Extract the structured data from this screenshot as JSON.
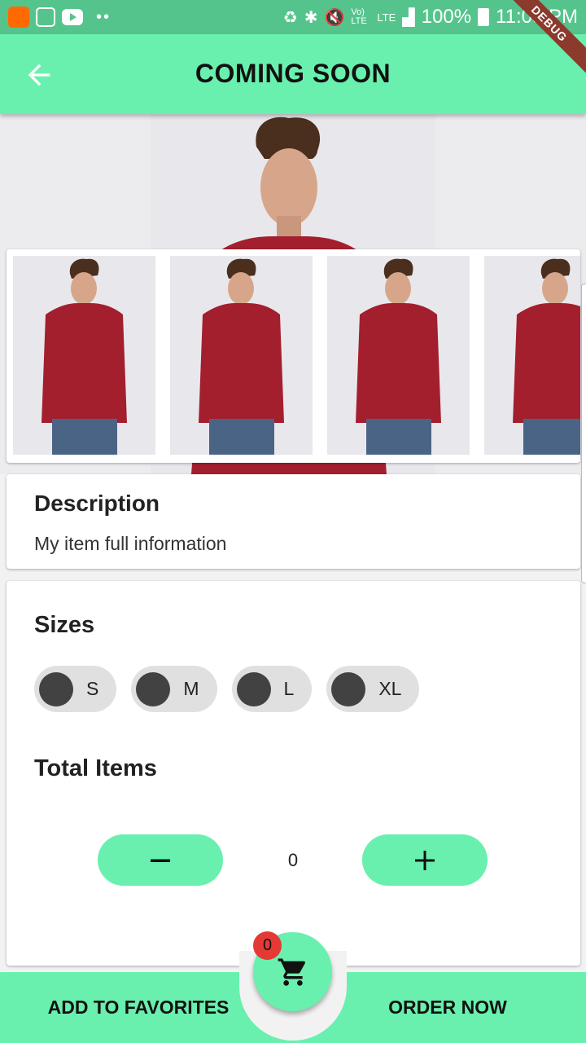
{
  "status_bar": {
    "time": "11:05 PM",
    "battery": "100%",
    "network": "LTE",
    "volte": "Vo) LTE",
    "icons": [
      "app-orange-icon",
      "app-outline-icon",
      "youtube-icon",
      "battery-saver-icon",
      "bluetooth-icon",
      "mute-icon",
      "signal-icon",
      "battery-icon"
    ]
  },
  "debug_banner": "DEBUG",
  "app_bar": {
    "title": "COMING SOON",
    "back_icon": "arrow-back-icon"
  },
  "description": {
    "title": "Description",
    "text": "My item full information"
  },
  "sizes": {
    "title": "Sizes",
    "options": [
      "S",
      "M",
      "L",
      "XL"
    ]
  },
  "quantity": {
    "title": "Total Items",
    "value": "0"
  },
  "bottom_bar": {
    "favorites_label": "ADD TO FAVORITES",
    "order_label": "ORDER NOW",
    "cart_badge": "0",
    "cart_icon": "shopping-cart-icon"
  },
  "colors": {
    "accent": "#69f0ae",
    "status_bar": "#55c48c",
    "badge": "#e53935",
    "chip_bg": "#e0e0e0",
    "chip_dot": "#424242"
  }
}
